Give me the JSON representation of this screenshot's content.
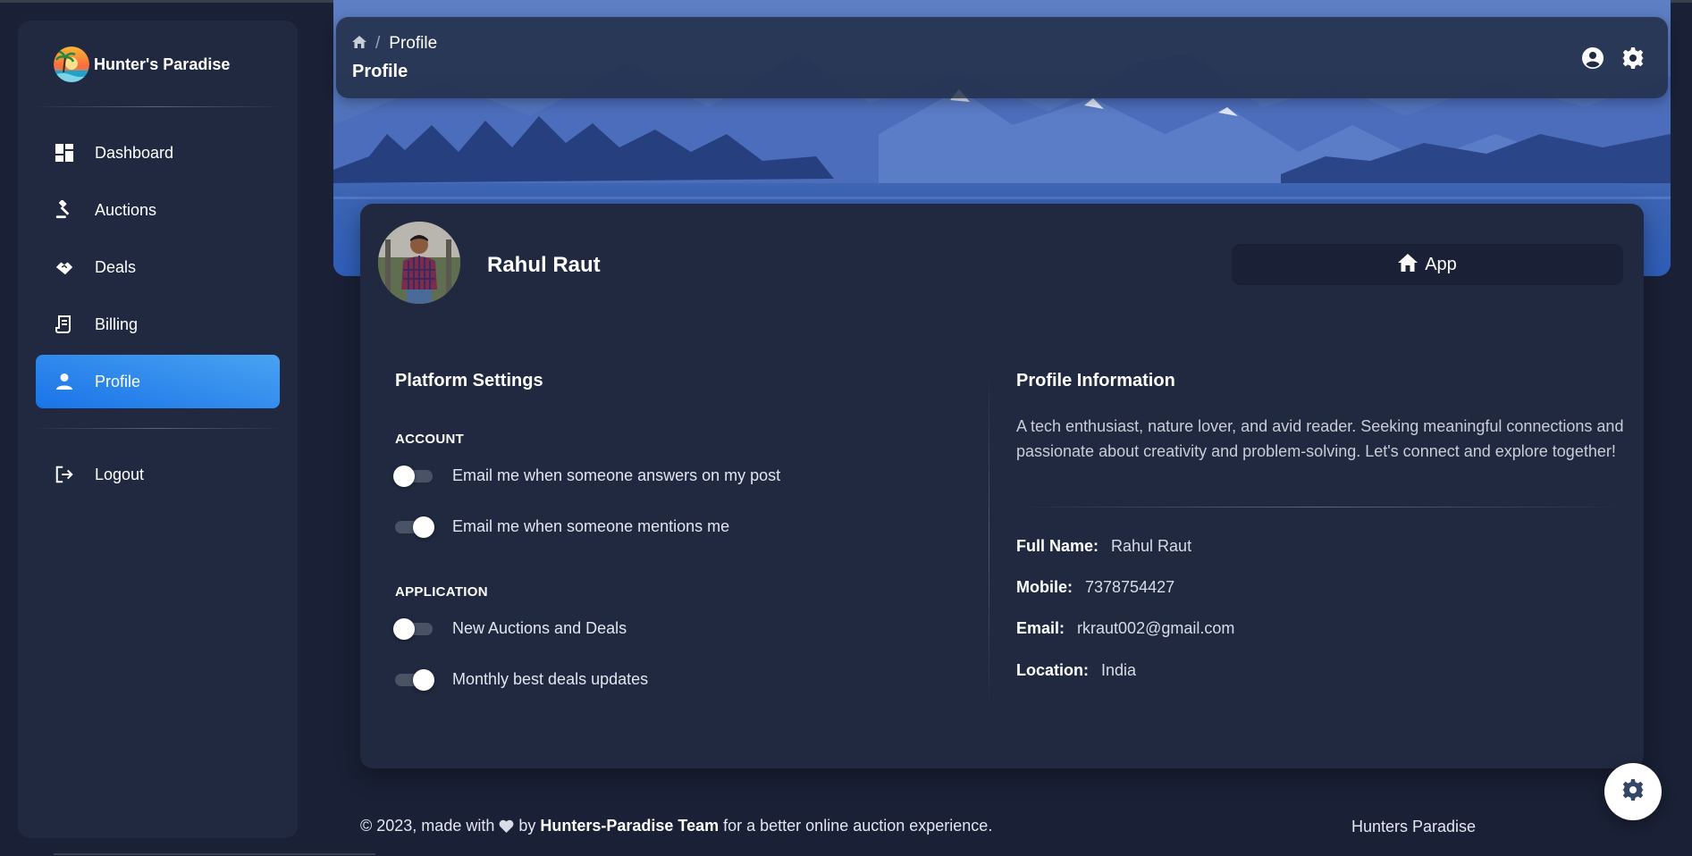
{
  "brand": {
    "name": "Hunter's Paradise"
  },
  "sidebar": {
    "items": [
      {
        "label": "Dashboard",
        "icon": "dashboard-icon",
        "active": false
      },
      {
        "label": "Auctions",
        "icon": "gavel-icon",
        "active": false
      },
      {
        "label": "Deals",
        "icon": "handshake-icon",
        "active": false
      },
      {
        "label": "Billing",
        "icon": "receipt-icon",
        "active": false
      },
      {
        "label": "Profile",
        "icon": "person-icon",
        "active": true
      }
    ],
    "logout": {
      "label": "Logout",
      "icon": "logout-icon"
    }
  },
  "topnav": {
    "breadcrumb": {
      "home_icon": "home-icon",
      "separator": "/",
      "current": "Profile"
    },
    "title": "Profile",
    "icons": [
      "account-circle-icon",
      "gear-icon"
    ]
  },
  "profile": {
    "name": "Rahul Raut",
    "app_tab": {
      "label": "App",
      "icon": "home-icon"
    }
  },
  "platform_settings": {
    "title": "Platform Settings",
    "account_label": "ACCOUNT",
    "account": [
      {
        "label": "Email me when someone answers on my post",
        "on": false
      },
      {
        "label": "Email me when someone mentions me",
        "on": true
      }
    ],
    "application_label": "APPLICATION",
    "application": [
      {
        "label": "New Auctions and Deals",
        "on": false
      },
      {
        "label": "Monthly best deals updates",
        "on": true
      }
    ]
  },
  "profile_info": {
    "title": "Profile Information",
    "bio": "A tech enthusiast, nature lover, and avid reader. Seeking meaningful connections and passionate about creativity and problem-solving. Let's connect and explore together!",
    "fields": [
      {
        "key": "Full Name:",
        "value": "Rahul Raut"
      },
      {
        "key": "Mobile:",
        "value": "7378754427"
      },
      {
        "key": "Email:",
        "value": "rkraut002@gmail.com"
      },
      {
        "key": "Location:",
        "value": "India"
      }
    ]
  },
  "footer": {
    "prefix": "© 2023, made with",
    "by": "by",
    "team": "Hunters-Paradise Team",
    "suffix": "for a better online auction experience.",
    "right": "Hunters Paradise"
  },
  "colors": {
    "background": "#1a2035",
    "card": "#202940",
    "active_gradient_start": "#49a3f1",
    "active_gradient_end": "#1a73e8"
  }
}
